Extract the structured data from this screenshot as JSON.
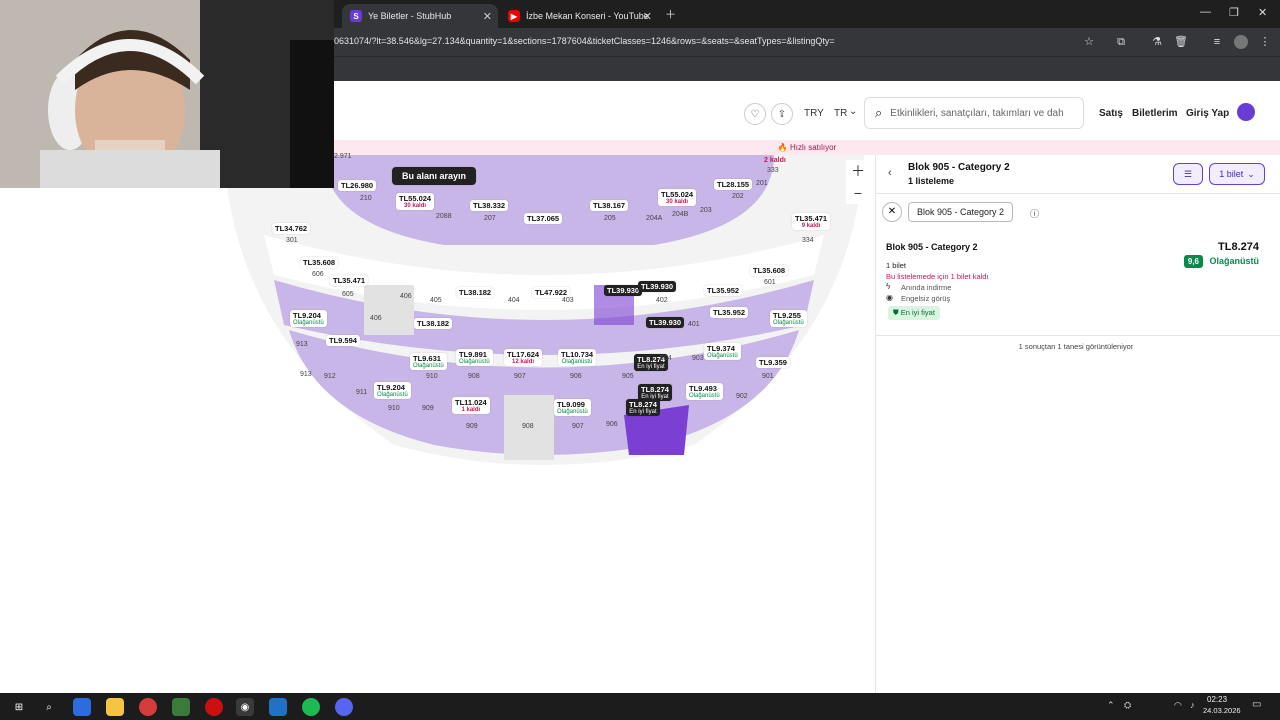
{
  "browser": {
    "tabs": [
      {
        "label": "Ye Biletler - StubHub",
        "favicon": "S"
      },
      {
        "label": "İzbe Mekan Konseri - YouTube",
        "favicon": "▶"
      }
    ],
    "url": "0631074/?lt=38.546&lg=27.134&quantity=1&sections=1787604&ticketClasses=1246&rows=&seats=&seatTypes=&listingQty="
  },
  "header": {
    "currency": "TRY",
    "language": "TR",
    "search_placeholder": "Etkinlikleri, sanatçıları, takımları ve dah",
    "nav": [
      "Satış",
      "Biletlerim",
      "Giriş Yap"
    ]
  },
  "banner": "Hızlı satılıyor",
  "map": {
    "search_area_button": "Bu alanı arayın",
    "prices": [
      {
        "text": "TL26.980"
      },
      {
        "text": "TL55.024",
        "sub": "30 kaldı",
        "kind": "r"
      },
      {
        "text": "TL38.332"
      },
      {
        "text": "TL37.065"
      },
      {
        "text": "TL38.167"
      },
      {
        "text": "TL55.024",
        "sub": "30 kaldı",
        "kind": "r"
      },
      {
        "text": "TL28.155"
      },
      {
        "text": "TL35.471",
        "sub": "9 kaldı",
        "kind": "r"
      },
      {
        "text": "TL34.762"
      },
      {
        "text": "TL35.608"
      },
      {
        "text": "TL35.471"
      },
      {
        "text": "TL38.182"
      },
      {
        "text": "TL47.922"
      },
      {
        "text": "TL39.930",
        "dark": true
      },
      {
        "text": "TL39.930",
        "dark": true
      },
      {
        "text": "TL35.952"
      },
      {
        "text": "TL35.608"
      },
      {
        "text": "TL38.182"
      },
      {
        "text": "TL39.930",
        "dark": true
      },
      {
        "text": "TL35.952"
      },
      {
        "text": "TL9.204",
        "sub": "Olağanüstü",
        "kind": "g"
      },
      {
        "text": "TL9.255",
        "sub": "Olağanüstü",
        "kind": "g"
      },
      {
        "text": "TL9.594"
      },
      {
        "text": "TL9.631",
        "sub": "Olağanüstü",
        "kind": "g"
      },
      {
        "text": "TL9.891",
        "sub": "Olağanüstü",
        "kind": "g"
      },
      {
        "text": "TL17.624",
        "sub": "12 kaldı",
        "kind": "r"
      },
      {
        "text": "TL10.734",
        "sub": "Olağanüstü",
        "kind": "g"
      },
      {
        "text": "TL8.274",
        "sub": "En iyi fiyat",
        "dark": true
      },
      {
        "text": "TL9.374",
        "sub": "Olağanüstü",
        "kind": "g"
      },
      {
        "text": "TL9.359"
      },
      {
        "text": "TL9.204",
        "sub": "Olağanüstü",
        "kind": "g"
      },
      {
        "text": "TL8.274",
        "sub": "En iyi fiyat",
        "dark": true
      },
      {
        "text": "TL9.493",
        "sub": "Olağanüstü",
        "kind": "g"
      },
      {
        "text": "TL11.024",
        "sub": "1 kaldı",
        "kind": "r"
      },
      {
        "text": "TL9.099",
        "sub": "Olağanüstü",
        "kind": "g"
      },
      {
        "text": "TL8.274",
        "sub": "En iyi fiyat",
        "dark": true
      }
    ],
    "sections": [
      "2.971",
      "210",
      "2088",
      "207",
      "205",
      "204A",
      "204B",
      "203",
      "202",
      "201",
      "333",
      "334",
      "301",
      "606",
      "605",
      "406",
      "405",
      "404",
      "403",
      "402",
      "401",
      "601",
      "406",
      "913",
      "912",
      "911",
      "910",
      "909",
      "908",
      "907",
      "906",
      "905",
      "904",
      "903",
      "902",
      "901",
      "913",
      "910",
      "909",
      "908",
      "907",
      "906",
      "2 kaldı"
    ]
  },
  "panel": {
    "title": "Blok 905 - Category 2",
    "subtitle": "1 listeleme",
    "filter_pill": "1 bilet",
    "chip": "Blok 905 - Category 2",
    "listing": {
      "title": "Blok 905 - Category 2",
      "price": "TL8.274",
      "qty": "1 bilet",
      "remaining": "Bu listelemede için 1 bilet kaldı",
      "feature1": "Anında indirme",
      "feature2": "Engelsiz görüş",
      "score": "9,6",
      "score_label": "Olağanüstü",
      "best": "En iyi fiyat"
    },
    "results": "1 sonuçtan 1 tanesi görüntüleniyor"
  },
  "taskbar": {
    "time": "02:23",
    "date": "24.03.2026"
  },
  "colors": {
    "accent": "#6a3cd6",
    "section": "#c9b6e8",
    "section_selected": "#7b3fd4",
    "good": "#0a8a4a",
    "urgent": "#c2185b"
  }
}
